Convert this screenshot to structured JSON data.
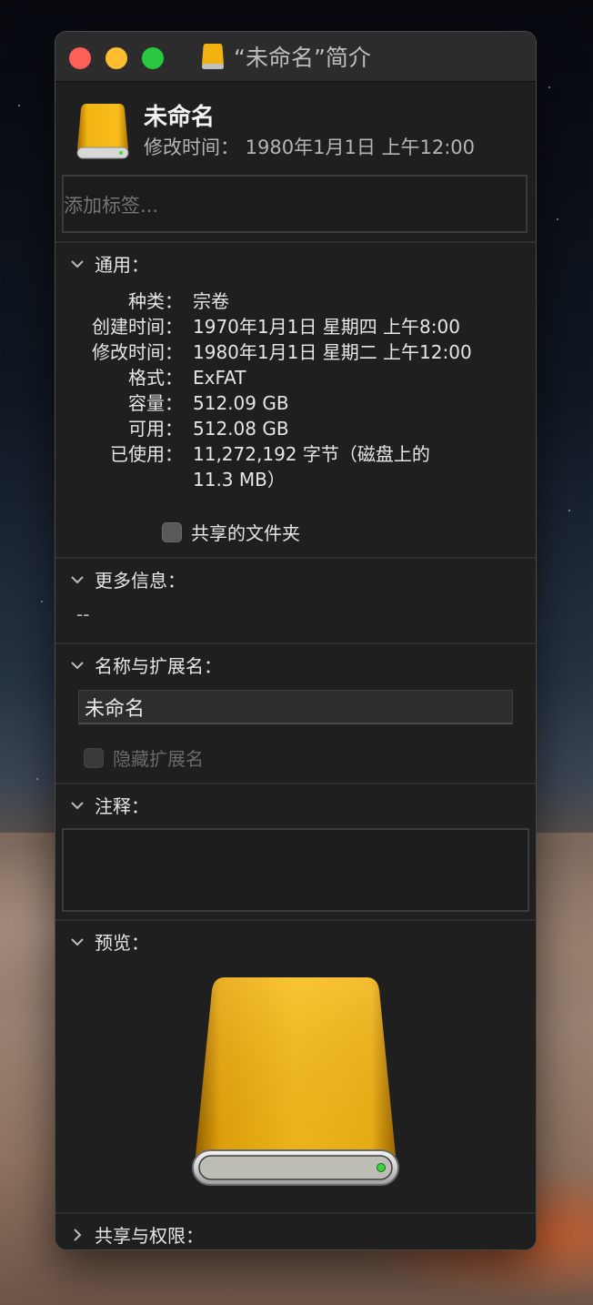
{
  "window": {
    "title": "“未命名”简介",
    "colors": {
      "close": "#fe5f57",
      "minimize": "#febc2e",
      "zoom": "#28c840",
      "drive": "#f5b60f",
      "led": "#3ddc3d"
    }
  },
  "header": {
    "name": "未命名",
    "modified": "修改时间：  1980年1月1日 上午12:00",
    "tags_placeholder": "添加标签..."
  },
  "general": {
    "title": "通用：",
    "rows": [
      {
        "key": "种类：",
        "value": "宗卷"
      },
      {
        "key": "创建时间：",
        "value": "1970年1月1日 星期四 上午8:00"
      },
      {
        "key": "修改时间：",
        "value": "1980年1月1日 星期二 上午12:00"
      },
      {
        "key": "格式：",
        "value": "ExFAT"
      },
      {
        "key": "容量：",
        "value": "512.09 GB"
      },
      {
        "key": "可用：",
        "value": "512.08 GB"
      },
      {
        "key": "已使用：",
        "value": "11,272,192 字节（磁盘上的",
        "value2": "11.3 MB）"
      }
    ],
    "shared_folder": "共享的文件夹"
  },
  "more_info": {
    "title": "更多信息：",
    "value": "--"
  },
  "name_ext": {
    "title": "名称与扩展名：",
    "name_value": "未命名",
    "hide_ext": "隐藏扩展名"
  },
  "comments": {
    "title": "注释："
  },
  "preview": {
    "title": "预览："
  },
  "sharing": {
    "title": "共享与权限："
  }
}
